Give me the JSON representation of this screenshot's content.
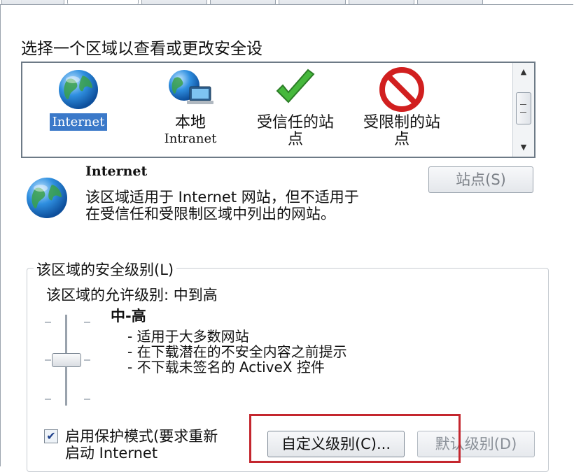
{
  "zones_prompt": "选择一个区域以查看或更改安全设",
  "zones": [
    {
      "name": "Internet",
      "sublabel": "",
      "icon": "globe-icon",
      "selected": true
    },
    {
      "name": "本地",
      "sublabel": "Intranet",
      "icon": "local-intranet-icon",
      "selected": false
    },
    {
      "name": "受信任的站",
      "sublabel": "点",
      "icon": "trusted-checkmark-icon",
      "selected": false
    },
    {
      "name": "受限制的站",
      "sublabel": "点",
      "icon": "restricted-sign-icon",
      "selected": false
    }
  ],
  "selected_zone": {
    "title": "Internet",
    "description_line1": "该区域适用于 Internet 网站，但不适用于",
    "description_line2": "在受信任和受限制区域中列出的网站。"
  },
  "sites_button": "站点(S)",
  "security_group": {
    "title": "该区域的安全级别(L)",
    "allowed_levels": "该区域的允许级别: 中到高",
    "level_name": "中-高",
    "bullets": [
      "- 适用于大多数网站",
      "- 在下载潜在的不安全内容之前提示",
      "- 不下载未签名的 ActiveX 控件"
    ]
  },
  "protected_mode": {
    "checked": true,
    "label_line1": "启用保护模式(要求重新",
    "label_line2": "启动 Internet"
  },
  "custom_level_button": "自定义级别(C)...",
  "default_level_button": "默认级别(D)",
  "colors": {
    "selection": "#3b79c9",
    "highlight_box": "#c4262e"
  }
}
